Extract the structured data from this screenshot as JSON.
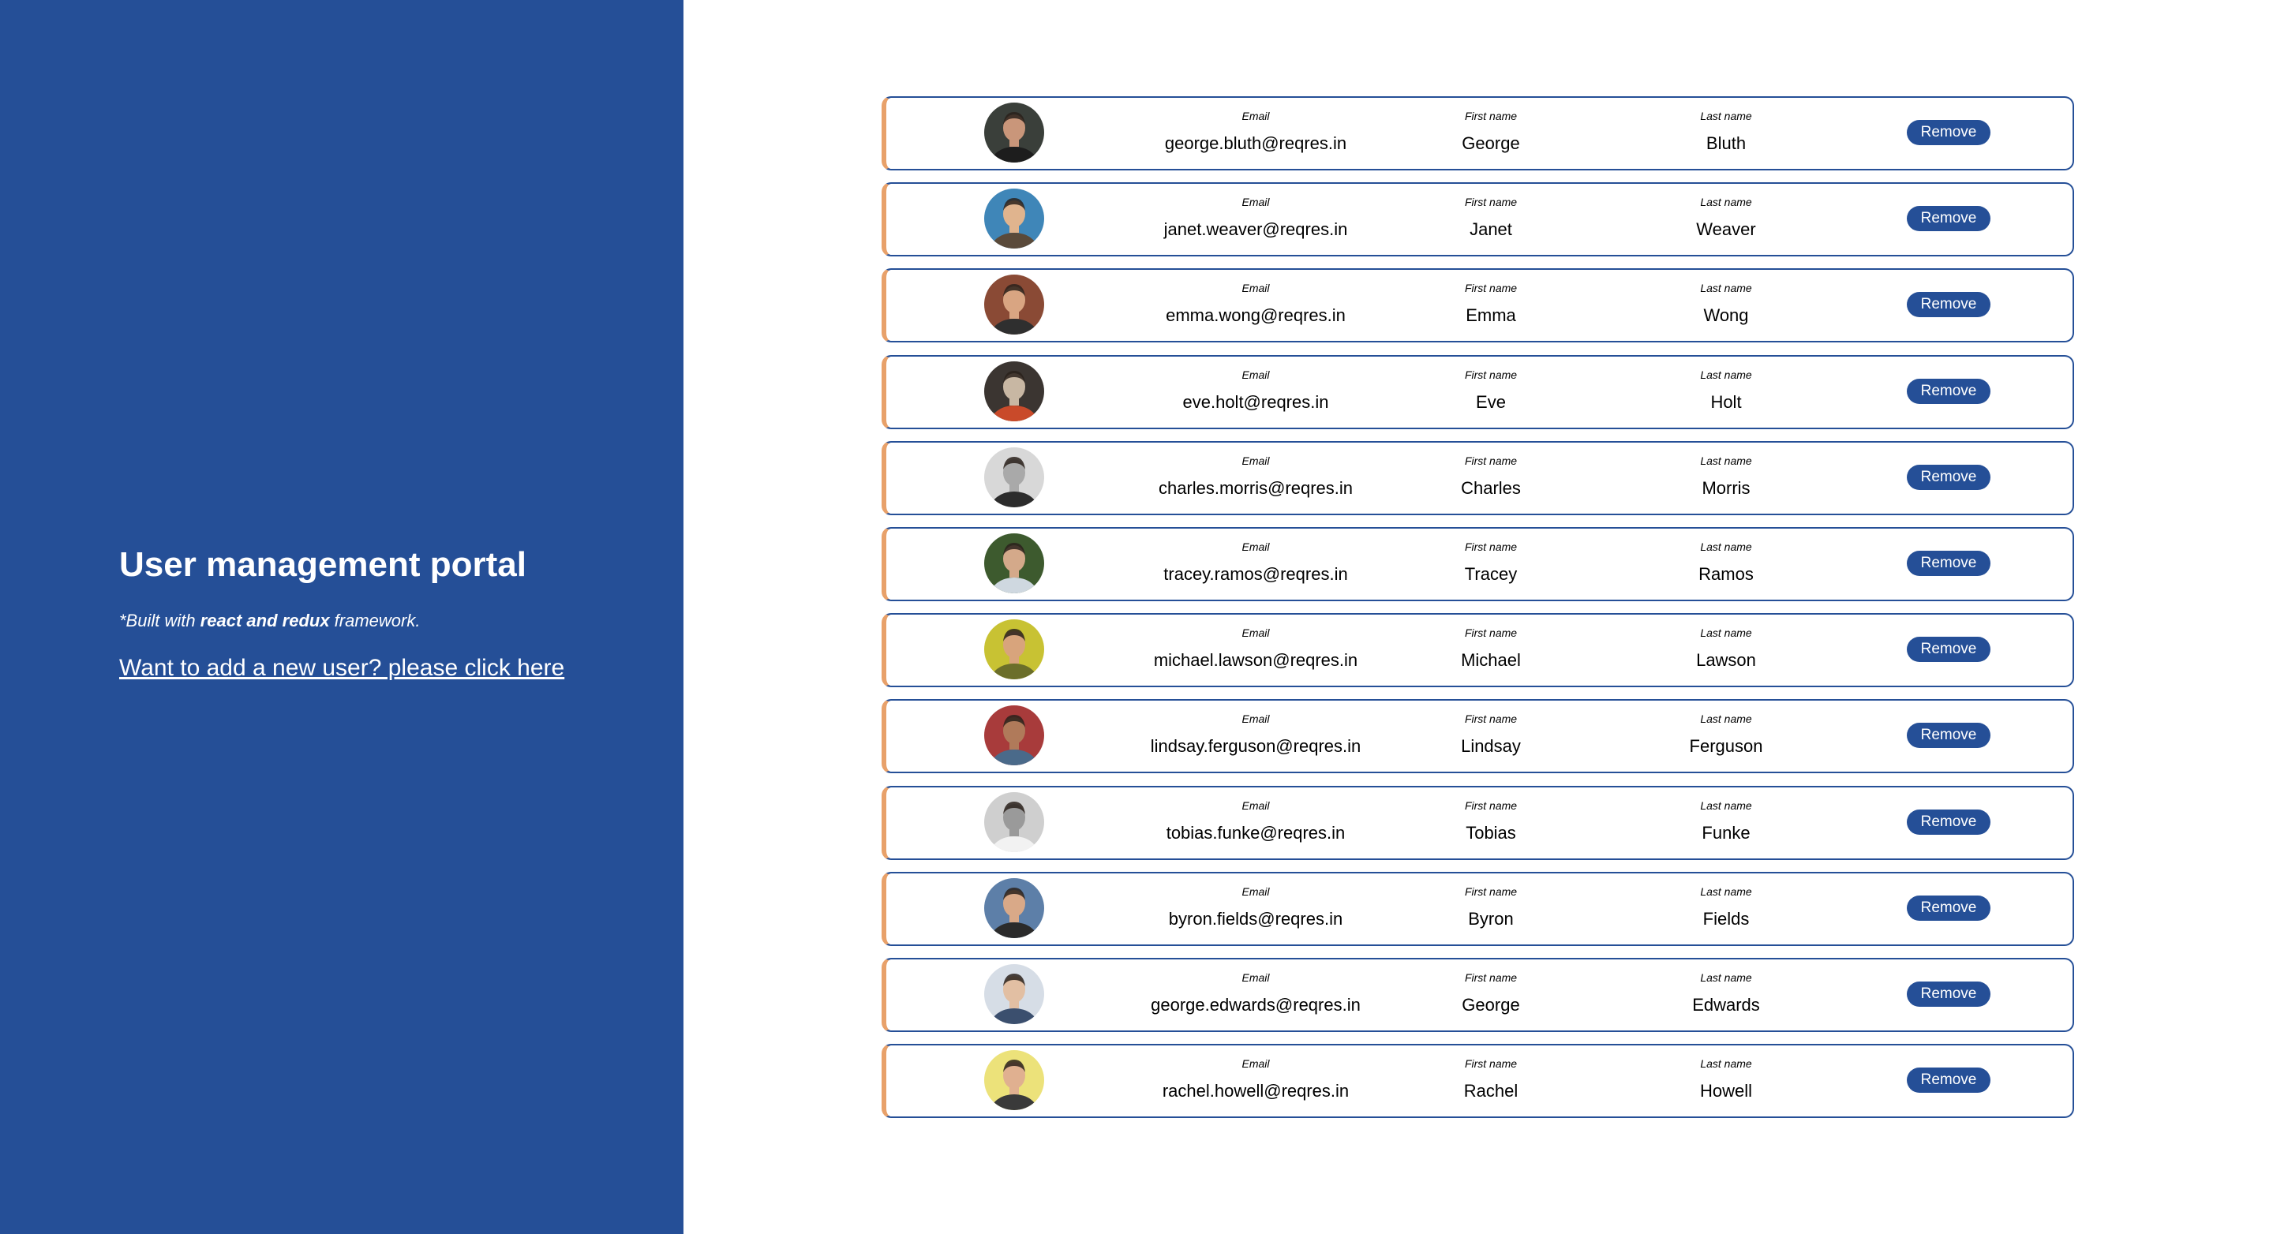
{
  "sidebar": {
    "title": "User management portal",
    "built_prefix": "*Built with ",
    "built_bold": "react and redux",
    "built_suffix": " framework.",
    "add_user_link": "Want to add a new user? please click here"
  },
  "labels": {
    "email": "Email",
    "first_name": "First name",
    "last_name": "Last name",
    "remove": "Remove"
  },
  "colors": {
    "sidebar_bg": "#254f97",
    "row_border": "#254f97",
    "row_accent": "#e8a16a",
    "button_bg": "#254f97"
  },
  "users": [
    {
      "email": "george.bluth@reqres.in",
      "first_name": "George",
      "last_name": "Bluth",
      "avatar": "user-avatar-icon",
      "avatar_bg": "#3a3f3a",
      "avatar_skin": "#c9967a",
      "avatar_shirt": "#1d1d1d"
    },
    {
      "email": "janet.weaver@reqres.in",
      "first_name": "Janet",
      "last_name": "Weaver",
      "avatar": "user-avatar-icon",
      "avatar_bg": "#3f86b8",
      "avatar_skin": "#e0b48e",
      "avatar_shirt": "#5a4a3a"
    },
    {
      "email": "emma.wong@reqres.in",
      "first_name": "Emma",
      "last_name": "Wong",
      "avatar": "user-avatar-icon",
      "avatar_bg": "#8a4a35",
      "avatar_skin": "#d9a582",
      "avatar_shirt": "#2f2f2f"
    },
    {
      "email": "eve.holt@reqres.in",
      "first_name": "Eve",
      "last_name": "Holt",
      "avatar": "user-avatar-icon",
      "avatar_bg": "#3b3531",
      "avatar_skin": "#c8b7a3",
      "avatar_shirt": "#c94a2a"
    },
    {
      "email": "charles.morris@reqres.in",
      "first_name": "Charles",
      "last_name": "Morris",
      "avatar": "user-avatar-icon",
      "avatar_bg": "#d8d8d8",
      "avatar_skin": "#a9a9a9",
      "avatar_shirt": "#2c2c2c"
    },
    {
      "email": "tracey.ramos@reqres.in",
      "first_name": "Tracey",
      "last_name": "Ramos",
      "avatar": "user-avatar-icon",
      "avatar_bg": "#3d5a2e",
      "avatar_skin": "#d4a98a",
      "avatar_shirt": "#cfd8e0"
    },
    {
      "email": "michael.lawson@reqres.in",
      "first_name": "Michael",
      "last_name": "Lawson",
      "avatar": "user-avatar-icon",
      "avatar_bg": "#c8c233",
      "avatar_skin": "#d8a47c",
      "avatar_shirt": "#6b6e2a"
    },
    {
      "email": "lindsay.ferguson@reqres.in",
      "first_name": "Lindsay",
      "last_name": "Ferguson",
      "avatar": "user-avatar-icon",
      "avatar_bg": "#a83b3b",
      "avatar_skin": "#b07a5a",
      "avatar_shirt": "#4a6a8a"
    },
    {
      "email": "tobias.funke@reqres.in",
      "first_name": "Tobias",
      "last_name": "Funke",
      "avatar": "user-avatar-icon",
      "avatar_bg": "#cfcfcf",
      "avatar_skin": "#9a9a9a",
      "avatar_shirt": "#f2f2f2"
    },
    {
      "email": "byron.fields@reqres.in",
      "first_name": "Byron",
      "last_name": "Fields",
      "avatar": "user-avatar-icon",
      "avatar_bg": "#5d7fa8",
      "avatar_skin": "#d9a988",
      "avatar_shirt": "#2b2b2b"
    },
    {
      "email": "george.edwards@reqres.in",
      "first_name": "George",
      "last_name": "Edwards",
      "avatar": "user-avatar-icon",
      "avatar_bg": "#d6dde6",
      "avatar_skin": "#e2bfa3",
      "avatar_shirt": "#3b4f6e"
    },
    {
      "email": "rachel.howell@reqres.in",
      "first_name": "Rachel",
      "last_name": "Howell",
      "avatar": "user-avatar-icon",
      "avatar_bg": "#ece27a",
      "avatar_skin": "#e0b090",
      "avatar_shirt": "#3a3a3a"
    }
  ]
}
